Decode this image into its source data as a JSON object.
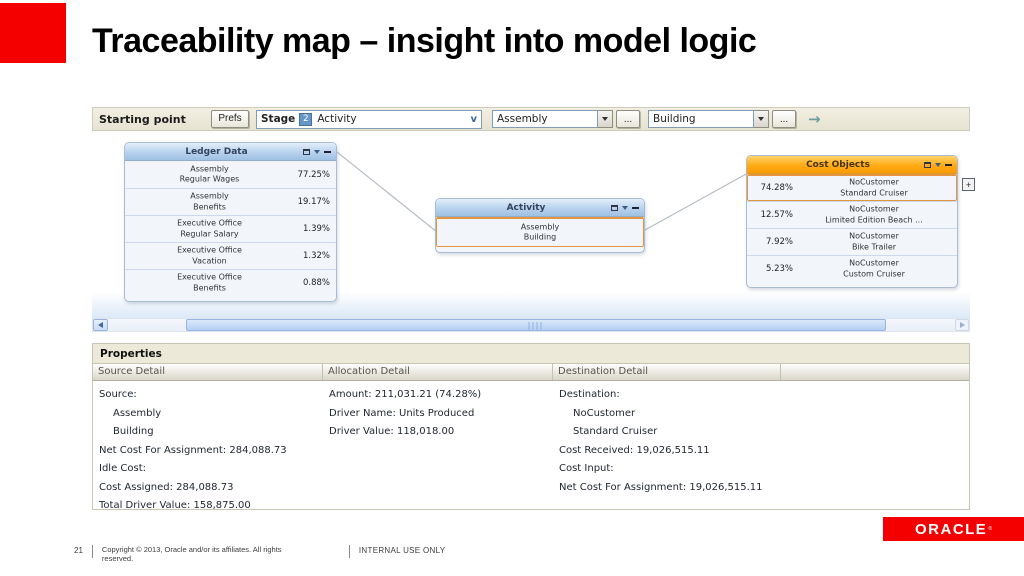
{
  "slide": {
    "title": "Traceability map – insight into model logic",
    "page_number": "21",
    "copyright_line1": "Copyright © 2013, Oracle and/or its affiliates. All rights",
    "copyright_line2": "reserved.",
    "classification": "INTERNAL USE ONLY",
    "logo_text": "ORACLE",
    "logo_reg": "®",
    "accent_color": "#f40000"
  },
  "toolbar": {
    "starting_point_label": "Starting point",
    "prefs_button": "Prefs",
    "stage_label": "Stage",
    "stage_number": "2",
    "stage_value": "Activity",
    "filter1_value": "Assembly",
    "filter2_value": "Building",
    "ellipsis_label": "...",
    "go_arrow": "→"
  },
  "map": {
    "ledger": {
      "title": "Ledger Data",
      "rows": [
        {
          "line1": "Assembly",
          "line2": "Regular Wages",
          "pct": "77.25%"
        },
        {
          "line1": "Assembly",
          "line2": "Benefits",
          "pct": "19.17%"
        },
        {
          "line1": "Executive Office",
          "line2": "Regular Salary",
          "pct": "1.39%"
        },
        {
          "line1": "Executive Office",
          "line2": "Vacation",
          "pct": "1.32%"
        },
        {
          "line1": "Executive Office",
          "line2": "Benefits",
          "pct": "0.88%"
        }
      ]
    },
    "activity": {
      "title": "Activity",
      "rows": [
        {
          "line1": "Assembly",
          "line2": "Building",
          "selected": true
        }
      ]
    },
    "cost_objects": {
      "title": "Cost Objects",
      "rows": [
        {
          "pct": "74.28%",
          "line1": "NoCustomer",
          "line2": "Standard Cruiser",
          "selected": true
        },
        {
          "pct": "12.57%",
          "line1": "NoCustomer",
          "line2": "Limited Edition Beach ..."
        },
        {
          "pct": "7.92%",
          "line1": "NoCustomer",
          "line2": "Bike Trailer"
        },
        {
          "pct": "5.23%",
          "line1": "NoCustomer",
          "line2": "Custom Cruiser"
        }
      ]
    },
    "expand_button_label": "+"
  },
  "properties": {
    "title": "Properties",
    "headers": [
      "Source Detail",
      "Allocation Detail",
      "Destination Detail",
      ""
    ],
    "source_lines": [
      {
        "text": "Source:"
      },
      {
        "text": "Assembly",
        "indent": true
      },
      {
        "text": "Building",
        "indent": true
      },
      {
        "text": "Net Cost For Assignment: 284,088.73"
      },
      {
        "text": "Idle Cost:"
      },
      {
        "text": "Cost Assigned: 284,088.73"
      },
      {
        "text": "Total Driver Value: 158,875.00"
      }
    ],
    "allocation_lines": [
      {
        "text": "Amount: 211,031.21 (74.28%)"
      },
      {
        "text": "Driver Name: Units Produced"
      },
      {
        "text": "Driver Value: 118,018.00"
      }
    ],
    "destination_lines": [
      {
        "text": "Destination:"
      },
      {
        "text": "NoCustomer",
        "indent": true
      },
      {
        "text": "Standard Cruiser",
        "indent": true
      },
      {
        "text": "Cost Received: 19,026,515.11"
      },
      {
        "text": "Cost Input:"
      },
      {
        "text": "Net Cost For Assignment: 19,026,515.11"
      }
    ]
  }
}
